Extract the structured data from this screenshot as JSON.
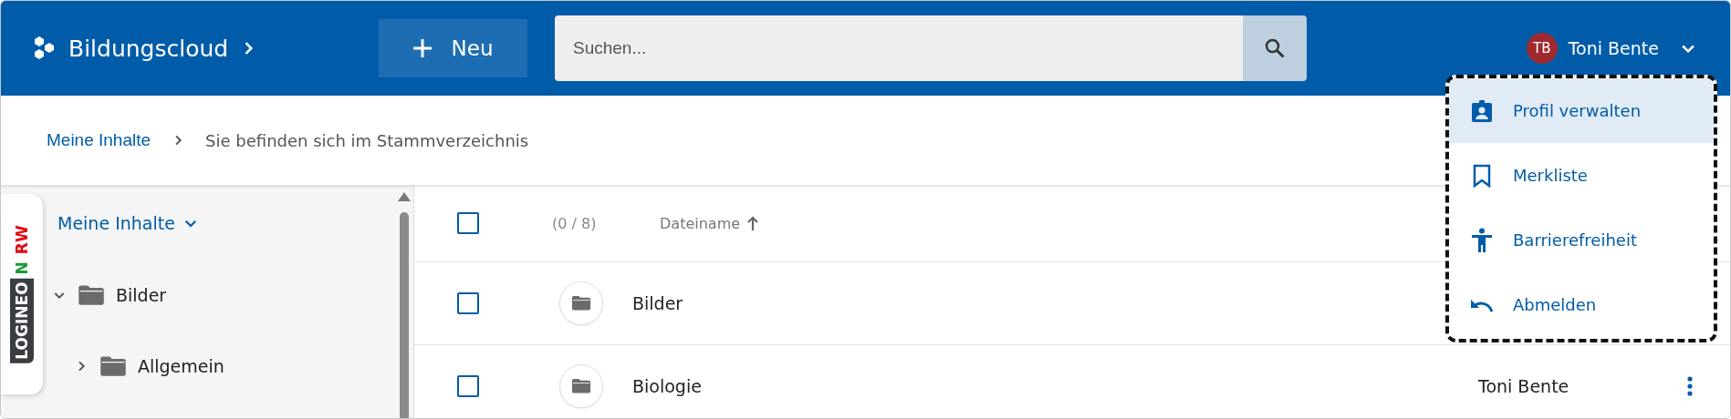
{
  "header": {
    "brand": "Bildungscloud",
    "new_button": "Neu",
    "search": {
      "placeholder": "Suchen..."
    },
    "user": {
      "initials": "TB",
      "name": "Toni Bente",
      "menu_expanded": true
    }
  },
  "user_menu": [
    {
      "kind": "profile",
      "label": "Profil verwalten",
      "selected": true
    },
    {
      "kind": "bookmark",
      "label": "Merkliste",
      "selected": false
    },
    {
      "kind": "accessibility",
      "label": "Barrierefreiheit",
      "selected": false
    },
    {
      "kind": "logout",
      "label": "Abmelden",
      "selected": false
    }
  ],
  "breadcrumb": {
    "link": "Meine Inhalte",
    "current": "Sie befinden sich im Stammverzeichnis"
  },
  "side_logo": [
    {
      "text": "LOGINEO",
      "kind": "band"
    },
    {
      "text": "N",
      "kind": "green"
    },
    {
      "text": "RW",
      "kind": "red"
    }
  ],
  "tree": {
    "label": "Meine Inhalte",
    "expanded": true,
    "children": [
      {
        "label": "Bilder",
        "expanded": true,
        "children": [
          {
            "label": "Allgemein",
            "expanded": false
          }
        ]
      }
    ]
  },
  "table": {
    "select_all": {
      "checked": false
    },
    "count": "(0 / 8)",
    "sort_column": "Dateiname",
    "rows": [
      {
        "name": "Bilder",
        "checked": false
      },
      {
        "name": "Biologie",
        "checked": false,
        "owner": "Toni Bente"
      }
    ]
  }
}
